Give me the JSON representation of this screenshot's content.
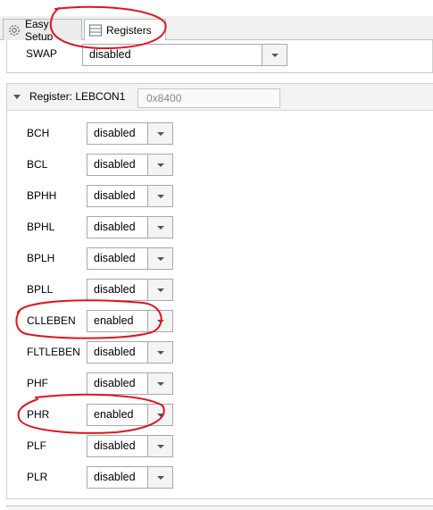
{
  "tabs": [
    {
      "label": "Easy Setup",
      "icon": "gear-icon"
    },
    {
      "label": "Registers",
      "icon": "registers-icon",
      "active": true
    }
  ],
  "swap": {
    "label": "SWAP",
    "value": "disabled"
  },
  "register": {
    "title": "Register: LEBCON1",
    "address": "0x8400",
    "fields": [
      {
        "label": "BCH",
        "value": "disabled"
      },
      {
        "label": "BCL",
        "value": "disabled"
      },
      {
        "label": "BPHH",
        "value": "disabled"
      },
      {
        "label": "BPHL",
        "value": "disabled"
      },
      {
        "label": "BPLH",
        "value": "disabled"
      },
      {
        "label": "BPLL",
        "value": "disabled"
      },
      {
        "label": "CLLEBEN",
        "value": "enabled"
      },
      {
        "label": "FLTLEBEN",
        "value": "disabled"
      },
      {
        "label": "PHF",
        "value": "disabled"
      },
      {
        "label": "PHR",
        "value": "enabled"
      },
      {
        "label": "PLF",
        "value": "disabled"
      },
      {
        "label": "PLR",
        "value": "disabled"
      }
    ]
  },
  "annotation_color": "#e0141e"
}
